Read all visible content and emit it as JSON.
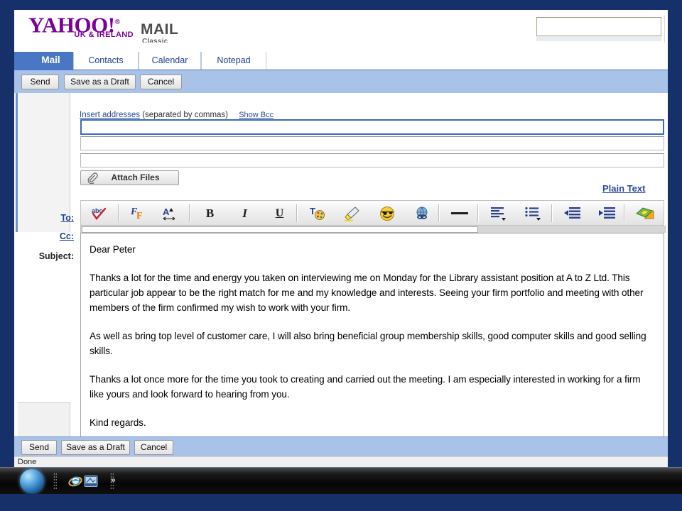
{
  "window": {
    "chrome_color": "#16306a"
  },
  "header": {
    "logo_text": "YAHOO!",
    "logo_registered": "®",
    "logo_region": "UK & IRELAND",
    "product_name": "MAIL",
    "product_edition": "Classic",
    "search_value": "",
    "search_placeholder": ""
  },
  "tabs": [
    {
      "label": "Mail",
      "active": true
    },
    {
      "label": "Contacts",
      "active": false
    },
    {
      "label": "Calendar",
      "active": false
    },
    {
      "label": "Notepad",
      "active": false
    }
  ],
  "toolbar_top": {
    "send_label": "Send",
    "save_draft_label": "Save as a Draft",
    "cancel_label": "Cancel"
  },
  "compose": {
    "insert_addresses_link": "Insert addresses",
    "insert_addresses_note": "(separated by commas)",
    "show_bcc_link": "Show Bcc",
    "to_label": "To:",
    "cc_label": "Cc:",
    "subject_label": "Subject:",
    "to_value": "",
    "cc_value": "",
    "subject_value": "",
    "to_placeholder": "",
    "cc_placeholder": "",
    "subject_placeholder": "",
    "attach_files_label": "Attach Files",
    "plain_text_link": "Plain Text"
  },
  "editor_toolbar": {
    "buttons": [
      {
        "name": "spellcheck-icon",
        "title": "Check Spelling"
      },
      {
        "name": "font-family-icon",
        "title": "Font"
      },
      {
        "name": "font-size-icon",
        "title": "Font Size"
      },
      {
        "name": "bold-icon",
        "title": "Bold",
        "glyph": "B"
      },
      {
        "name": "italic-icon",
        "title": "Italic",
        "glyph": "I"
      },
      {
        "name": "underline-icon",
        "title": "Underline",
        "glyph": "U"
      },
      {
        "name": "text-color-icon",
        "title": "Text Colour"
      },
      {
        "name": "highlighter-icon",
        "title": "Highlight"
      },
      {
        "name": "emoticon-icon",
        "title": "Insert Emoticon"
      },
      {
        "name": "insert-link-icon",
        "title": "Insert Link"
      },
      {
        "name": "horizontal-rule-icon",
        "title": "Horizontal Rule"
      },
      {
        "name": "align-icon",
        "title": "Alignment"
      },
      {
        "name": "list-icon",
        "title": "Lists"
      },
      {
        "name": "decrease-indent-icon",
        "title": "Decrease Indent"
      },
      {
        "name": "increase-indent-icon",
        "title": "Increase Indent"
      },
      {
        "name": "stationery-icon",
        "title": "Stationery"
      }
    ]
  },
  "message": {
    "paragraphs": [
      "Dear Peter",
      "Thanks a lot for the time and energy you taken on interviewing me on Monday for the Library assistant position at A to Z Ltd. This particular job appear to be the right match for me and my knowledge and interests. Seeing your firm portfolio and meeting with other members of the firm confirmed my wish to work with your firm.",
      "As well as bring top level of customer care, I will also bring beneficial group membership skills, good computer skills and good selling skills.",
      "Thanks a lot once more for the time you took to creating and carried out the meeting. I am especially interested in working for a firm like yours and look forward to hearing from you.",
      "Kind regards."
    ]
  },
  "toolbar_bottom": {
    "send_label": "Send",
    "save_draft_label": "Save as a Draft",
    "cancel_label": "Cancel"
  },
  "status_bar": {
    "text": "Done"
  },
  "taskbar": {
    "start_label": "Start",
    "more_chevron": "»",
    "items": [
      {
        "name": "internet-explorer-icon"
      },
      {
        "name": "media-player-icon"
      }
    ]
  },
  "colors": {
    "frame_navy": "#16306a",
    "tab_blue": "#4a77c4",
    "action_bar_blue": "#a9c2e8",
    "link_blue": "#2b4b9b",
    "yahoo_purple": "#7b0099"
  }
}
